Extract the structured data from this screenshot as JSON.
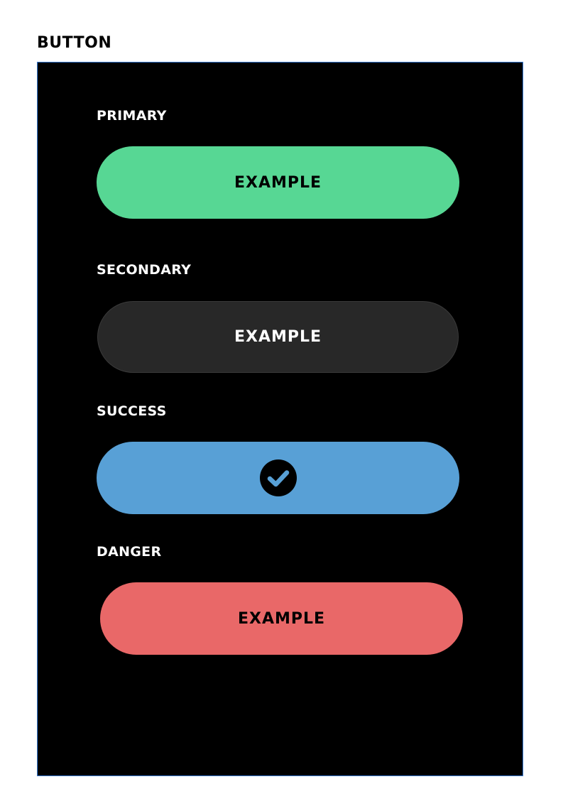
{
  "page": {
    "title": "BUTTON"
  },
  "sections": {
    "primary": {
      "label": "PRIMARY",
      "button_label": "EXAMPLE",
      "bg_color": "#57d794",
      "text_color": "#000000"
    },
    "secondary": {
      "label": "SECONDARY",
      "button_label": "EXAMPLE",
      "bg_color": "#282828",
      "text_color": "#ffffff"
    },
    "success": {
      "label": "SUCCESS",
      "icon": "check-circle-icon",
      "bg_color": "#58a0d6",
      "icon_color": "#000000"
    },
    "danger": {
      "label": "DANGER",
      "button_label": "EXAMPLE",
      "bg_color": "#e96868",
      "text_color": "#000000"
    }
  },
  "colors": {
    "frame_background": "#000000",
    "frame_border": "#3b7dd8",
    "page_background": "#ffffff"
  }
}
